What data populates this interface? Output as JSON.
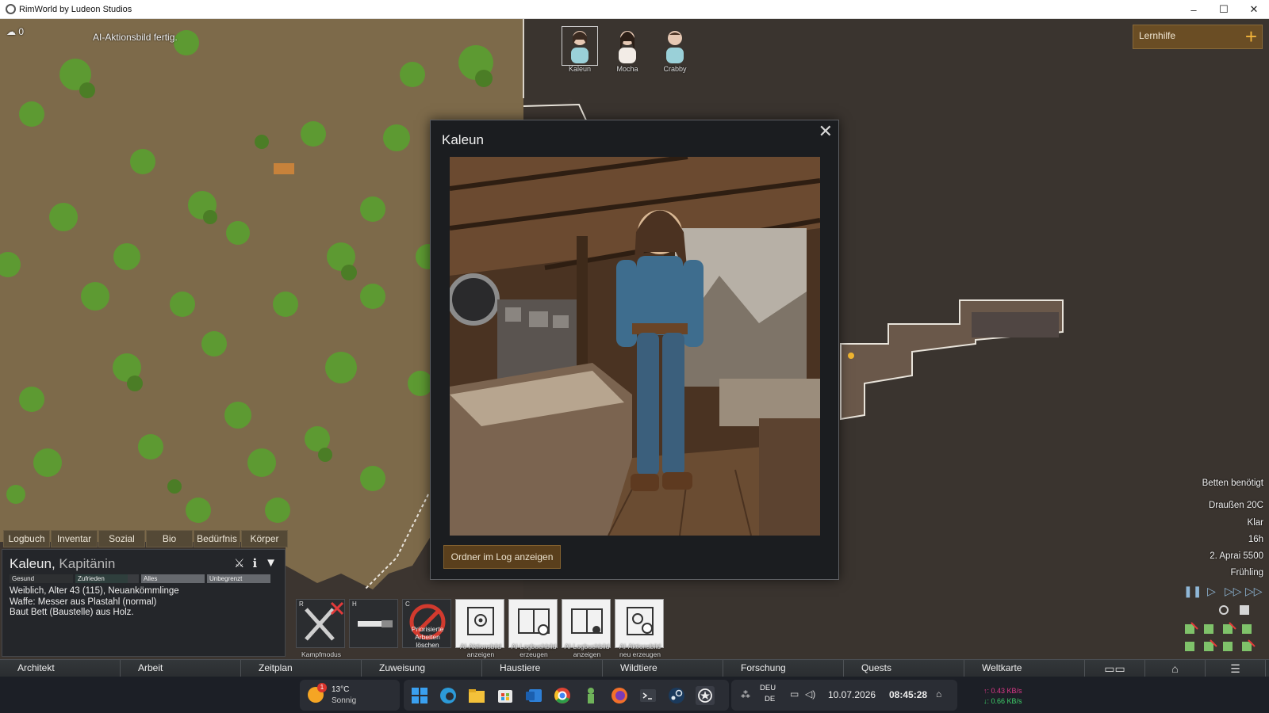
{
  "window": {
    "title": "RimWorld by Ludeon Studios",
    "minimize_glyph": "–",
    "maximize_glyph": "☐",
    "close_glyph": "✕"
  },
  "hud": {
    "resource_count": "0",
    "message": "AI-Aktionsbild fertig."
  },
  "colonists": [
    {
      "name": "Kaleun",
      "selected": true
    },
    {
      "name": "Mocha",
      "selected": false
    },
    {
      "name": "Crabby",
      "selected": false
    }
  ],
  "learning_helper": {
    "label": "Lernhilfe",
    "plus_glyph": "+"
  },
  "dialog": {
    "title": "Kaleun",
    "close_glyph": "✕",
    "button": "Ordner im Log anzeigen"
  },
  "inspector_tabs": [
    "Logbuch",
    "Inventar",
    "Sozial",
    "Bio",
    "Bedürfnis",
    "Körper"
  ],
  "inspector": {
    "name": "Kaleun",
    "separator": ",",
    "role": "Kapitänin",
    "icon_glyphs": [
      "⚔",
      "ℹ",
      "▼"
    ],
    "bars": [
      {
        "label": "Gesund",
        "fill": 1.0,
        "color": "#2e3032"
      },
      {
        "label": "Zufrieden",
        "fill": 0.82,
        "color": "#2f3f3d"
      },
      {
        "label": "Alles",
        "fill": 1.0,
        "color": "#66696e"
      },
      {
        "label": "Unbegrenzt",
        "fill": 1.0,
        "color": "#66696e"
      }
    ],
    "lines": [
      "Weiblich, Alter 43 (115), Neuankömmlinge",
      "Waffe: Messer aus Plastahl (normal)",
      "Baut Bett (Baustelle) aus Holz."
    ]
  },
  "gizmos": [
    {
      "hotkey": "R",
      "label": "Kampfmodus",
      "icon": "crossed-swords-icon"
    },
    {
      "hotkey": "H",
      "label": "",
      "icon": "knife-icon"
    },
    {
      "hotkey": "C",
      "label": "Priorisierte Arbeiten löschen",
      "icon": "no-entry-icon"
    },
    {
      "hotkey": "",
      "label": "AI-Aktionsbild anzeigen",
      "icon": "view-image-icon"
    },
    {
      "hotkey": "",
      "label": "AI-Logbuchbild erzeugen",
      "icon": "logbook-generate-icon"
    },
    {
      "hotkey": "",
      "label": "AI-Logbuchbild anzeigen",
      "icon": "logbook-view-icon"
    },
    {
      "hotkey": "",
      "label": "AI-Aktionsbild neu erzeugen",
      "icon": "regenerate-image-icon"
    }
  ],
  "right_info": {
    "alert": "Betten benötigt",
    "outdoor_temp": "Draußen 20C",
    "weather": "Klar",
    "hour": "16h",
    "date": "2. Aprai 5500",
    "season": "Frühling"
  },
  "speed_controls": [
    "pause",
    "normal",
    "fast",
    "superfast"
  ],
  "main_tabs": [
    "Architekt",
    "Arbeit",
    "Zeitplan",
    "Zuweisung",
    "Haustiere",
    "Wildtiere",
    "Forschung",
    "Quests",
    "Weltkarte"
  ],
  "main_tab_icons": [
    "book-icon",
    "factions-icon",
    "menu-icon"
  ],
  "taskbar": {
    "weather_temp": "13°C",
    "weather_desc": "Sonnig",
    "weather_badge": "1",
    "lang_code": "DEU",
    "lang_region": "DE",
    "date": "10.07.2026",
    "time": "08:45:28",
    "net_up": "↑: 0.43 KB/s",
    "net_down": "↓: 0.66 KB/s",
    "apps": [
      "windows-start-icon",
      "edge-icon",
      "file-explorer-icon",
      "store-icon",
      "outlook-icon",
      "chrome-icon",
      "app-icon",
      "firefox-icon",
      "terminal-icon",
      "steam-icon",
      "rimworld-icon"
    ]
  },
  "colors": {
    "accent_button": "#5a3f1c",
    "dialog_bg": "#1b1d20",
    "net_up": "#e0388a",
    "net_down": "#3fd06a"
  }
}
